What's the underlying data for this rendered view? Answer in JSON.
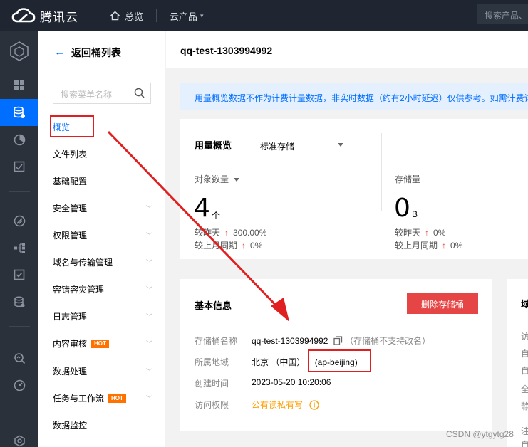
{
  "topbar": {
    "brand": "腾讯云",
    "home": "总览",
    "products": "云产品",
    "search_placeholder": "搜索产品、"
  },
  "rail": {
    "icons": [
      "cube-icon",
      "dashboard-icon",
      "storage-icon",
      "pie-chart-icon",
      "image-check-icon",
      "signal-icon",
      "network-icon",
      "check-square-icon",
      "database-icon",
      "search-analytics-icon",
      "gauge-icon",
      "bottom-hexagon-icon"
    ],
    "active_index": 2
  },
  "menu": {
    "back_label": "返回桶列表",
    "search_placeholder": "搜索菜单名称",
    "items": [
      {
        "label": "概览",
        "active": true,
        "expandable": false,
        "hot": false
      },
      {
        "label": "文件列表",
        "active": false,
        "expandable": false,
        "hot": false
      },
      {
        "label": "基础配置",
        "active": false,
        "expandable": false,
        "hot": false
      },
      {
        "label": "安全管理",
        "active": false,
        "expandable": true,
        "hot": false
      },
      {
        "label": "权限管理",
        "active": false,
        "expandable": true,
        "hot": false
      },
      {
        "label": "域名与传输管理",
        "active": false,
        "expandable": true,
        "hot": false
      },
      {
        "label": "容错容灾管理",
        "active": false,
        "expandable": true,
        "hot": false
      },
      {
        "label": "日志管理",
        "active": false,
        "expandable": true,
        "hot": false
      },
      {
        "label": "内容审核",
        "active": false,
        "expandable": true,
        "hot": true
      },
      {
        "label": "数据处理",
        "active": false,
        "expandable": true,
        "hot": false
      },
      {
        "label": "任务与工作流",
        "active": false,
        "expandable": true,
        "hot": true
      },
      {
        "label": "数据监控",
        "active": false,
        "expandable": false,
        "hot": false
      }
    ],
    "hot_label": "HOT"
  },
  "page": {
    "title": "qq-test-1303994992",
    "notice": "用量概览数据不作为计费计量数据，非实时数据（约有2小时延迟）仅供参考。如需计费详"
  },
  "usage": {
    "title": "用量概览",
    "storage_class": "标准存储",
    "objects": {
      "label": "对象数量",
      "value": "4",
      "unit": "个",
      "day_label": "较昨天",
      "day_change": "300.00%",
      "month_label": "较上月同期",
      "month_change": "0%"
    },
    "storage": {
      "label": "存储量",
      "value": "0",
      "unit": "B",
      "day_label": "较昨天",
      "day_change": "0%",
      "month_label": "较上月同期",
      "month_change": "0%"
    }
  },
  "basic": {
    "title": "基本信息",
    "delete_label": "删除存储桶",
    "name_label": "存储桶名称",
    "name_value": "qq-test-1303994992",
    "name_note": "（存储桶不支持改名）",
    "region_label": "所属地域",
    "region_value": "北京 （中国）",
    "region_code": "(ap-beijing)",
    "created_label": "创建时间",
    "created_value": "2023-05-20 10:20:06",
    "access_label": "访问权限",
    "access_value": "公有读私有写"
  },
  "side_card": {
    "title": "域",
    "lines": [
      "访",
      "自",
      "自",
      "全",
      "静",
      "注",
      "自"
    ]
  },
  "watermark": "CSDN @ytgytg28"
}
